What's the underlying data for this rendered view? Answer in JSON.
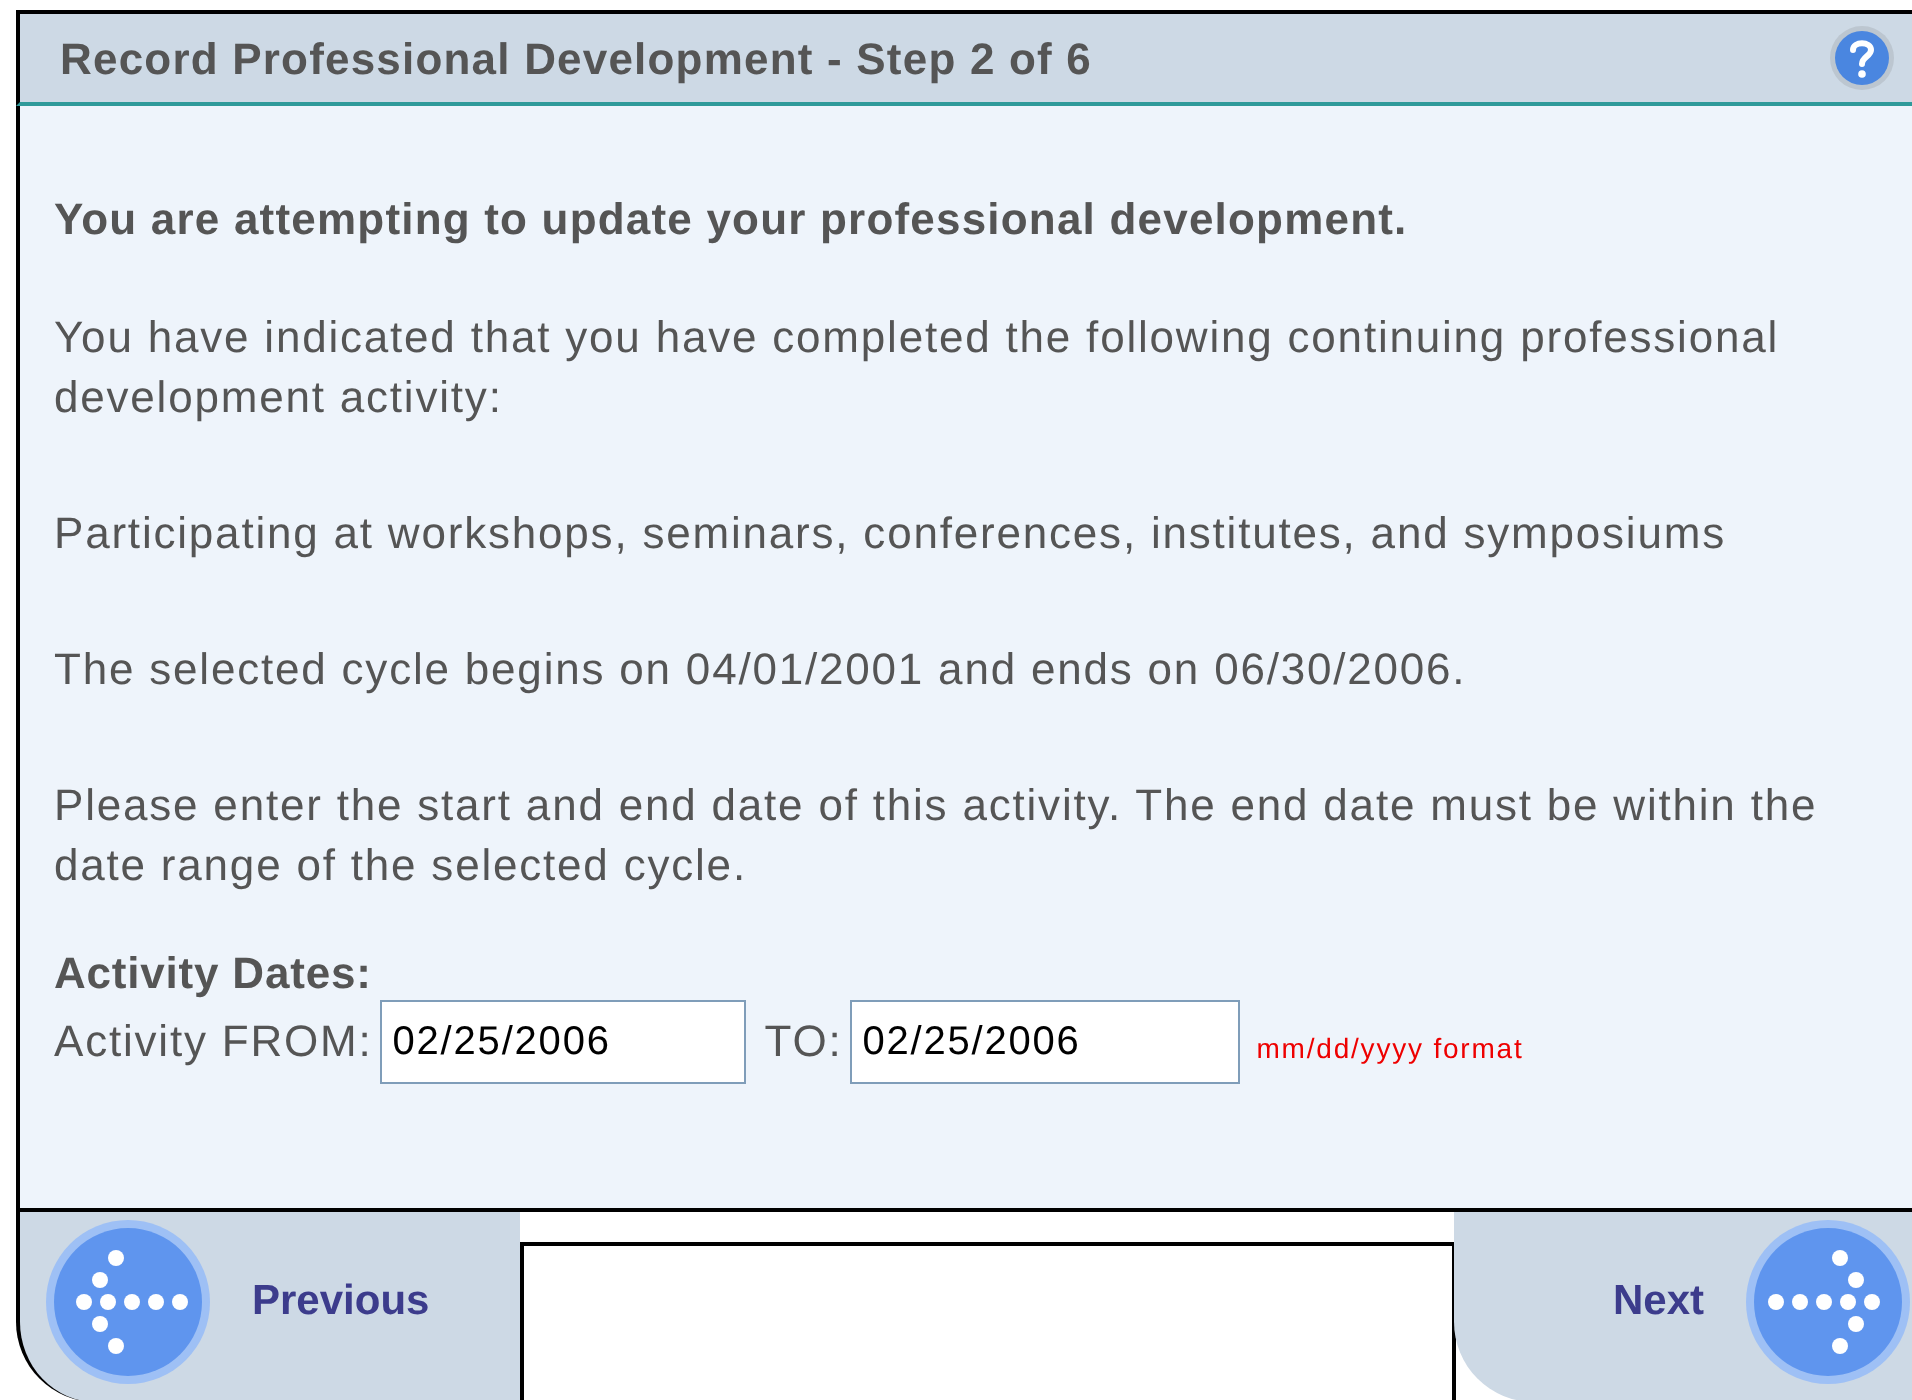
{
  "window": {
    "title": "Record Professional Development - Step 2 of 6"
  },
  "heading": "You are attempting to update your professional development.",
  "paragraphs": [
    "You have indicated that you have completed the following continuing professional development activity:",
    "Participating at workshops, seminars, conferences, institutes, and symposiums",
    "The selected cycle begins on 04/01/2001 and ends on 06/30/2006.",
    "Please enter the start and end date of this activity. The end date must be within the date range of the selected cycle."
  ],
  "activity_dates": {
    "title": "Activity Dates:",
    "from_label": "Activity FROM:",
    "from_value": "02/25/2006",
    "to_label": "TO:",
    "to_value": "02/25/2006",
    "format_hint": "mm/dd/yyyy format"
  },
  "footer": {
    "previous": "Previous",
    "next": "Next"
  }
}
